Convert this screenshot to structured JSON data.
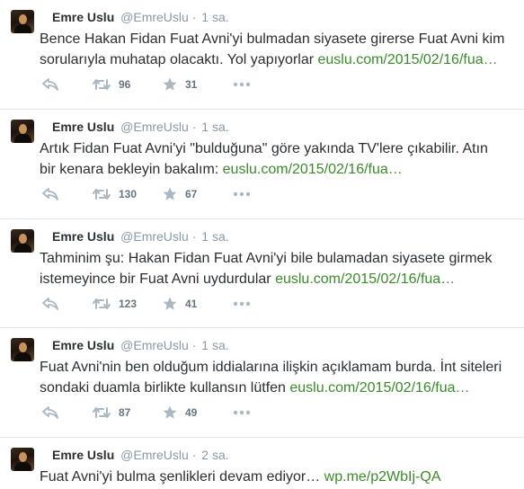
{
  "colors": {
    "link": "#3b8a2a",
    "name": "#292f33",
    "meta": "#8899a6",
    "action": "#8899a6",
    "divider": "#e1e8ed"
  },
  "tweets": [
    {
      "name": "Emre Uslu",
      "username": "@EmreUslu",
      "dot": "·",
      "time": "1 sa.",
      "text": "Bence Hakan Fidan Fuat Avni'yi bulmadan siyasete girerse Fuat Avni kim sorularıyla muhatap olacaktı. Yol yapıyorlar ",
      "link": "euslu.com/2015/02/16/fua…",
      "retweets": "96",
      "favorites": "31"
    },
    {
      "name": "Emre Uslu",
      "username": "@EmreUslu",
      "dot": "·",
      "time": "1 sa.",
      "text": "Artık Fidan Fuat Avni'yi \"bulduğuna\" göre yakında TV'lere çıkabilir. Atın bir kenara bekleyin bakalım: ",
      "link": "euslu.com/2015/02/16/fua…",
      "retweets": "130",
      "favorites": "67"
    },
    {
      "name": "Emre Uslu",
      "username": "@EmreUslu",
      "dot": "·",
      "time": "1 sa.",
      "text": "Tahminim şu: Hakan Fidan Fuat Avni'yi bile bulamadan siyasete girmek istemeyince bir Fuat Avni uydurdular ",
      "link": "euslu.com/2015/02/16/fua…",
      "retweets": "123",
      "favorites": "41"
    },
    {
      "name": "Emre Uslu",
      "username": "@EmreUslu",
      "dot": "·",
      "time": "1 sa.",
      "text": "Fuat Avni'nin ben olduğum iddialarına ilişkin açıklamam burda. İnt siteleri sondaki duamla birlikte kullansın lütfen ",
      "link": "euslu.com/2015/02/16/fua…",
      "retweets": "87",
      "favorites": "49"
    },
    {
      "name": "Emre Uslu",
      "username": "@EmreUslu",
      "dot": "·",
      "time": "2 sa.",
      "text": "Fuat Avni'yi bulma şenlikleri devam ediyor… ",
      "link": "wp.me/p2WbIj-QA"
    }
  ],
  "icons": {
    "reply": "reply-icon",
    "retweet": "retweet-icon",
    "favorite": "star-icon",
    "more": "more-icon"
  }
}
